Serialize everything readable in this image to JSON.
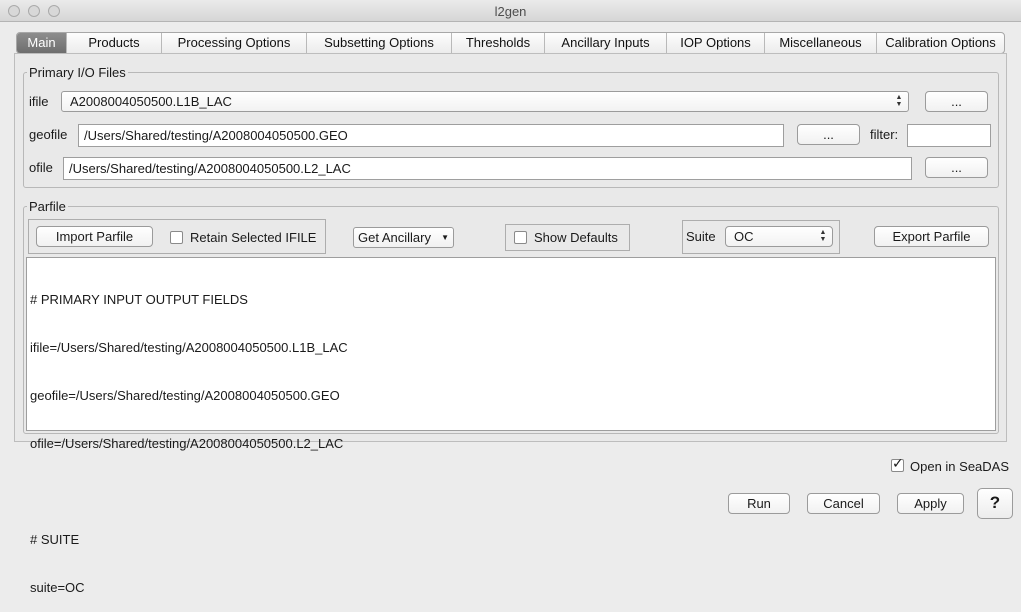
{
  "window": {
    "title": "l2gen"
  },
  "tabs": [
    {
      "label": "Main"
    },
    {
      "label": "Products"
    },
    {
      "label": "Processing Options"
    },
    {
      "label": "Subsetting Options"
    },
    {
      "label": "Thresholds"
    },
    {
      "label": "Ancillary Inputs"
    },
    {
      "label": "IOP Options"
    },
    {
      "label": "Miscellaneous"
    },
    {
      "label": "Calibration Options"
    }
  ],
  "primary_io": {
    "legend": "Primary I/O Files",
    "ifile_label": "ifile",
    "ifile_value": "A2008004050500.L1B_LAC",
    "geofile_label": "geofile",
    "geofile_value": "/Users/Shared/testing/A2008004050500.GEO",
    "ofile_label": "ofile",
    "ofile_value": "/Users/Shared/testing/A2008004050500.L2_LAC",
    "browse_label": "...",
    "filter_label": "filter:",
    "filter_value": ""
  },
  "parfile": {
    "legend": "Parfile",
    "import_label": "Import Parfile",
    "retain_label": "Retain Selected IFILE",
    "retain_checked": false,
    "get_ancillary_label": "Get Ancillary",
    "show_defaults_label": "Show Defaults",
    "show_defaults_checked": false,
    "suite_label": "Suite",
    "suite_value": "OC",
    "export_label": "Export Parfile",
    "lines": [
      "# PRIMARY INPUT OUTPUT FIELDS",
      "ifile=/Users/Shared/testing/A2008004050500.L1B_LAC",
      "geofile=/Users/Shared/testing/A2008004050500.GEO",
      "ofile=/Users/Shared/testing/A2008004050500.L2_LAC",
      "",
      "# SUITE",
      "suite=OC"
    ]
  },
  "footer": {
    "open_seadas_label": "Open in SeaDAS",
    "open_seadas_checked": true,
    "run_label": "Run",
    "cancel_label": "Cancel",
    "apply_label": "Apply",
    "help_label": "?"
  }
}
